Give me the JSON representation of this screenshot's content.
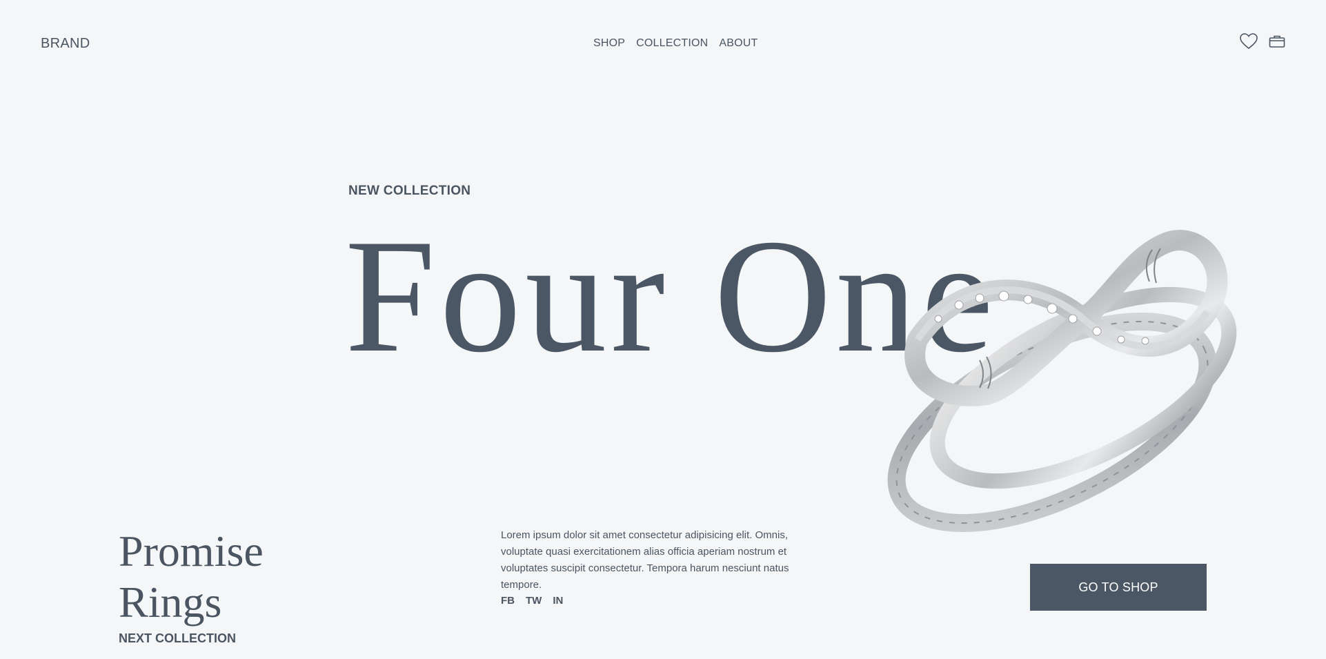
{
  "header": {
    "brand": "BRAND",
    "nav": [
      "SHOP",
      "COLLECTION",
      "ABOUT"
    ],
    "icons": [
      "heart-icon",
      "briefcase-icon"
    ]
  },
  "hero": {
    "eyebrow": "NEW COLLECTION",
    "title": "Four One",
    "image": "ring-image"
  },
  "next": {
    "title_line1": "Promise",
    "title_line2": "Rings",
    "label": "NEXT COLLECTION"
  },
  "description": "Lorem ipsum dolor sit amet consectetur adipisicing elit. Omnis, voluptate quasi exercitationem alias officia aperiam nostrum et voluptates suscipit consectetur. Tempora harum nesciunt natus tempore.",
  "social": [
    "FB",
    "TW",
    "IN"
  ],
  "cta": {
    "label": "GO TO SHOP"
  },
  "colors": {
    "background": "#f4f6f8",
    "text": "#4a5561",
    "button": "#4b5764",
    "button_text": "#ffffff"
  }
}
